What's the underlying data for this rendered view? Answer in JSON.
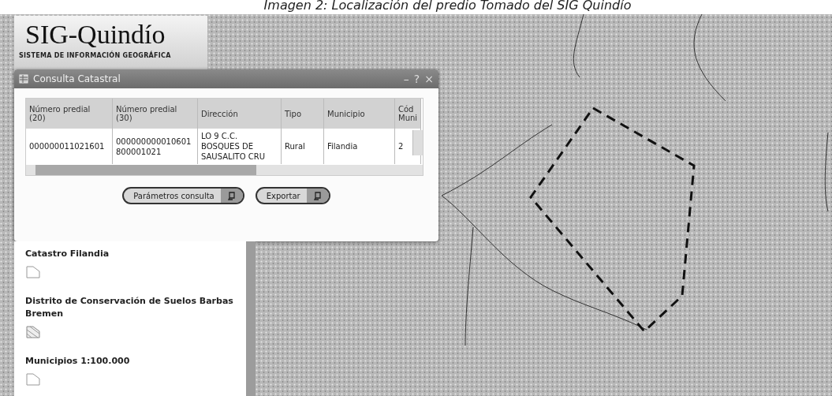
{
  "caption": "Imagen 2: Localización del predio Tomado del SIG Quindío",
  "logo": {
    "title": "SIG-Quindío",
    "subtitle": "SISTEMA DE INFORMACIÓN GEOGRÁFICA"
  },
  "dialog": {
    "title": "Consulta Catastral",
    "controls": [
      "–",
      "?",
      "×"
    ],
    "table": {
      "columns": [
        "Número predial (20)",
        "Número predial (30)",
        "Dirección",
        "Tipo",
        "Municipio",
        "Cód Muni"
      ],
      "rows": [
        [
          "000000011021601",
          "000000000010601 800001021",
          "LO 9 C.C. BOSQUES DE SAUSALITO CRU",
          "Rural",
          "Filandia",
          "2"
        ]
      ]
    },
    "buttons": [
      {
        "label": "Parámetros consulta"
      },
      {
        "label": "Exportar"
      }
    ]
  },
  "legend": [
    {
      "title": "Catastro Filandia",
      "kind": "outline"
    },
    {
      "title": "Distrito de Conservación de Suelos Barbas Bremen",
      "kind": "hatched"
    },
    {
      "title": "Municipios 1:100.000",
      "kind": "outline"
    }
  ]
}
